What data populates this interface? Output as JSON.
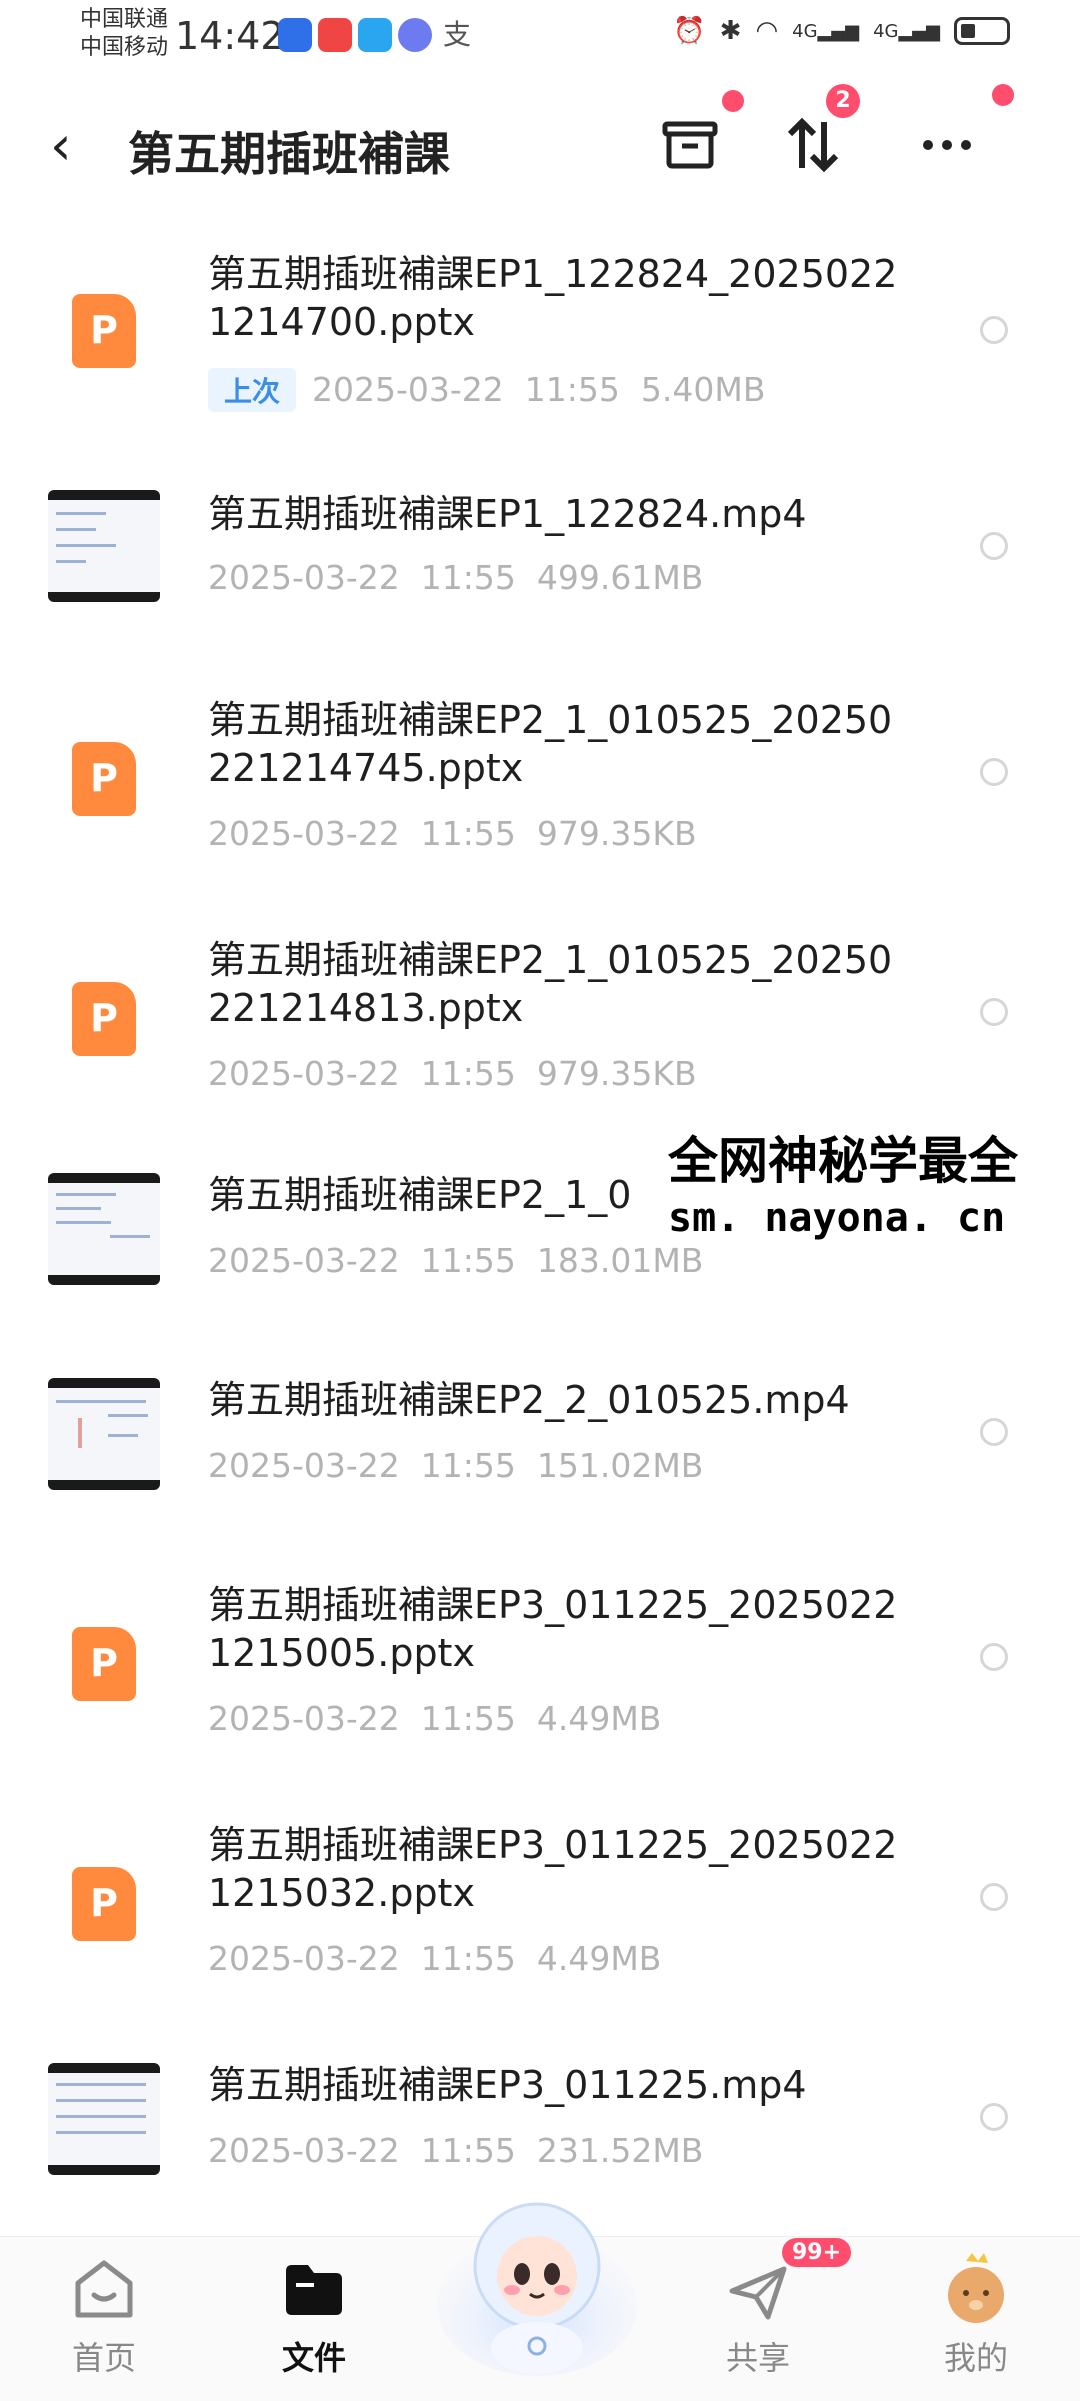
{
  "status_bar": {
    "carrier_1": "中国联通",
    "carrier_2": "中国移动",
    "time": "14:42",
    "network_1": "4G",
    "network_2": "4G"
  },
  "header": {
    "title": "第五期插班補課",
    "sort_badge": "2"
  },
  "files": [
    {
      "name": "第五期插班補課EP1_122824_20250221214700.pptx",
      "type": "pptx",
      "tag": "上次",
      "date": "2025-03-22",
      "time": "11:55",
      "size": "5.40MB"
    },
    {
      "name": "第五期插班補課EP1_122824.mp4",
      "type": "mp4",
      "date": "2025-03-22",
      "time": "11:55",
      "size": "499.61MB"
    },
    {
      "name": "第五期插班補課EP2_1_010525_20250221214745.pptx",
      "type": "pptx",
      "date": "2025-03-22",
      "time": "11:55",
      "size": "979.35KB"
    },
    {
      "name": "第五期插班補課EP2_1_010525_20250221214813.pptx",
      "type": "pptx",
      "date": "2025-03-22",
      "time": "11:55",
      "size": "979.35KB"
    },
    {
      "name": "第五期插班補課EP2_1_0",
      "type": "mp4",
      "date": "2025-03-22",
      "time": "11:55",
      "size": "183.01MB"
    },
    {
      "name": "第五期插班補課EP2_2_010525.mp4",
      "type": "mp4",
      "date": "2025-03-22",
      "time": "11:55",
      "size": "151.02MB"
    },
    {
      "name": "第五期插班補課EP3_011225_20250221215005.pptx",
      "type": "pptx",
      "date": "2025-03-22",
      "time": "11:55",
      "size": "4.49MB"
    },
    {
      "name": "第五期插班補課EP3_011225_20250221215032.pptx",
      "type": "pptx",
      "date": "2025-03-22",
      "time": "11:55",
      "size": "4.49MB"
    },
    {
      "name": "第五期插班補課EP3_011225.mp4",
      "type": "mp4",
      "date": "2025-03-22",
      "time": "11:55",
      "size": "231.52MB"
    }
  ],
  "watermark": {
    "line1": "全网神秘学最全",
    "line2": "sm. nayona. cn"
  },
  "nav": {
    "home": "首页",
    "files": "文件",
    "share": "共享",
    "share_badge": "99+",
    "mine": "我的"
  },
  "colors": {
    "ppt_orange": "#ff8a3d",
    "badge_red": "#ff4d6d",
    "tag_blue": "#3a8ee6"
  }
}
